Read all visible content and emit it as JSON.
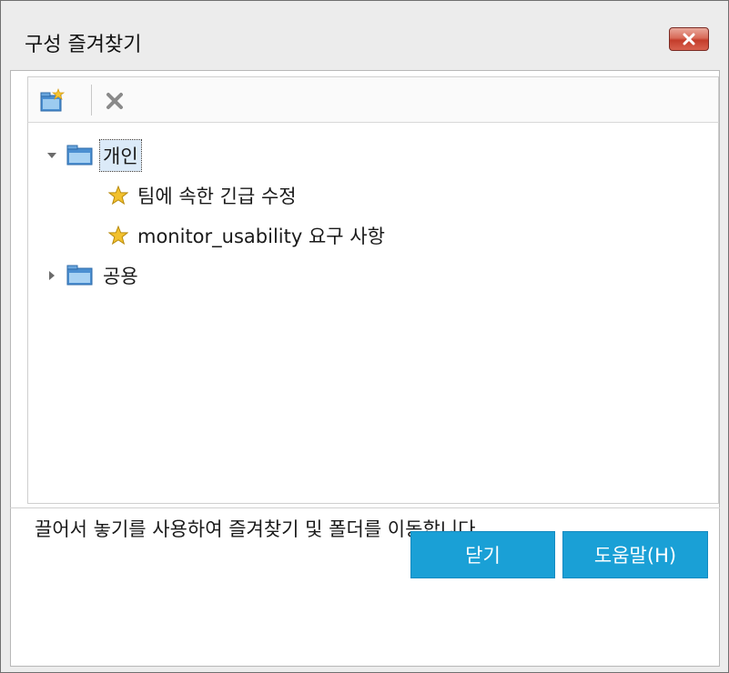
{
  "window": {
    "title": "구성 즐겨찾기"
  },
  "icons": {
    "close": "close-icon",
    "new_folder": "new-folder-icon",
    "delete": "delete-icon",
    "folder": "folder-icon",
    "star": "star-icon",
    "expand": "triangle-down-icon",
    "collapse": "triangle-right-icon"
  },
  "tree": {
    "personal_folder": "개인",
    "favorites": [
      "팀에 속한 긴급 수정",
      "monitor_usability 요구 사항"
    ],
    "public_folder": "공용"
  },
  "hint": "끌어서 놓기를 사용하여 즐겨찾기 및 폴더를 이동합니다.",
  "buttons": {
    "close_label": "닫기",
    "help_label": "도움말(H)"
  },
  "colors": {
    "accent": "#1aa0d6",
    "close_red": "#c43d2b",
    "selection": "#dbeaf8",
    "star": "#f2c12e",
    "folder_blue": "#4b8fd1"
  }
}
